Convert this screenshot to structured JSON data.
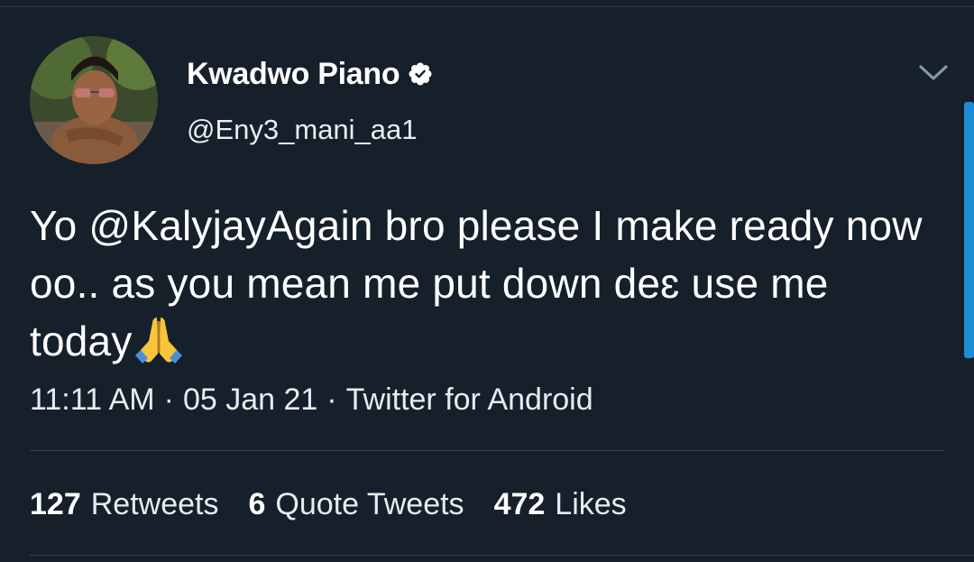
{
  "author": {
    "display_name": "Kwadwo Piano",
    "handle": "@Eny3_mani_aa1",
    "avatar_icon": "profile-photo",
    "verified_icon": "verified-badge-icon"
  },
  "tweet": {
    "text": "Yo @KalyjayAgain bro please I make ready now oo.. as you mean me put down deɛ use me today",
    "emoji": "folded-hands-emoji",
    "time": "11:11 AM",
    "date": "05 Jan 21",
    "source": "Twitter for Android",
    "separator": "·"
  },
  "stats": {
    "retweets_count": "127",
    "retweets_label": "Retweets",
    "quotes_count": "6",
    "quotes_label": "Quote Tweets",
    "likes_count": "472",
    "likes_label": "Likes"
  },
  "colors": {
    "background": "#15202b",
    "text": "#ffffff",
    "divider": "#38444d",
    "accent": "#1d8cd6"
  }
}
